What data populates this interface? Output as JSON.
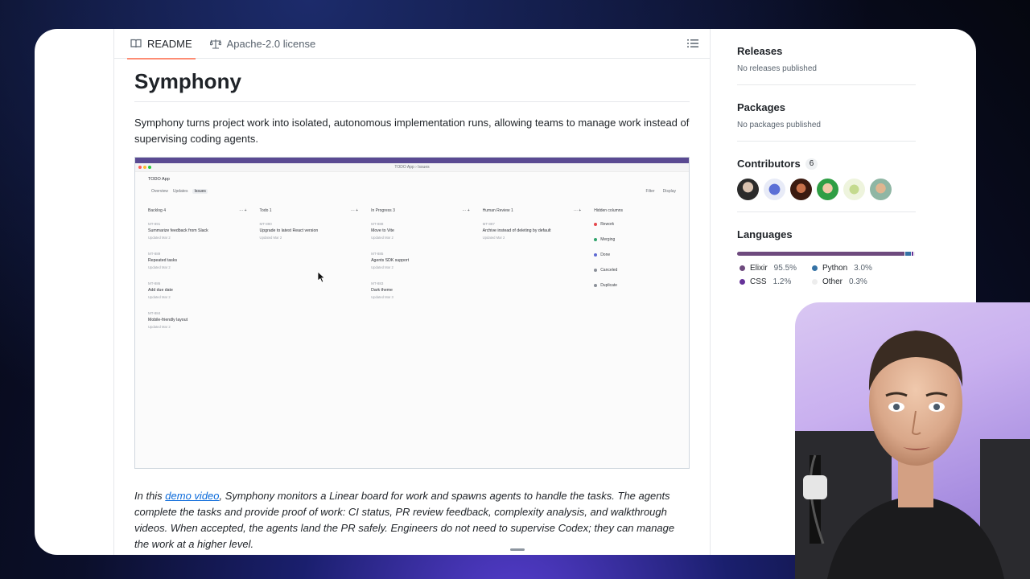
{
  "readme": {
    "tabs": [
      {
        "label": "README",
        "active": true
      },
      {
        "label": "Apache-2.0 license",
        "active": false
      }
    ],
    "title": "Symphony",
    "intro": "Symphony turns project work into isolated, autonomous implementation runs, allowing teams to manage work instead of supervising coding agents.",
    "screenshot": {
      "window_title": "TODO App › Issues",
      "app_name": "TODO App",
      "subtabs": [
        "Overview",
        "Updates",
        "Issues"
      ],
      "active_subtab": "Issues",
      "filter_label": "Filter",
      "display_label": "Display",
      "columns": [
        {
          "name": "Backlog",
          "count": "4",
          "color": "#b5b9c0",
          "cards": [
            {
              "id": "MT-891",
              "title": "Summarize feedback from Slack",
              "updated": "Updated Mar 2"
            },
            {
              "id": "MT-889",
              "title": "Repeated tasks",
              "updated": "Updated Mar 2"
            },
            {
              "id": "MT-886",
              "title": "Add due date",
              "updated": "Updated Mar 2"
            },
            {
              "id": "MT-884",
              "title": "Mobile-friendly layout",
              "updated": "Updated Mar 2"
            }
          ]
        },
        {
          "name": "Todo",
          "count": "1",
          "color": "#8a8f98",
          "cards": [
            {
              "id": "MT-890",
              "title": "Upgrade to latest React version",
              "updated": "Updated Mar 2"
            }
          ]
        },
        {
          "name": "In Progress",
          "count": "3",
          "color": "#e6b800",
          "cards": [
            {
              "id": "MT-888",
              "title": "Move to Vite",
              "updated": "Updated Mar 2"
            },
            {
              "id": "MT-885",
              "title": "Agents SDK support",
              "updated": "Updated Mar 2"
            },
            {
              "id": "MT-883",
              "title": "Dark theme",
              "updated": "Updated Mar 3"
            }
          ]
        },
        {
          "name": "Human Review",
          "count": "1",
          "color": "#e5484d",
          "cards": [
            {
              "id": "MT-887",
              "title": "Archive instead of deleting by default",
              "updated": "Updated Mar 2"
            }
          ]
        }
      ],
      "hidden_columns": {
        "label": "Hidden columns",
        "items": [
          {
            "label": "Rework",
            "color": "#e5484d"
          },
          {
            "label": "Merging",
            "color": "#30a46c"
          },
          {
            "label": "Done",
            "color": "#5e6ad2"
          },
          {
            "label": "Canceled",
            "color": "#8a8f98"
          },
          {
            "label": "Duplicate",
            "color": "#8a8f98"
          }
        ]
      }
    },
    "para": {
      "before": "In this ",
      "link": "demo video",
      "after": ", Symphony monitors a Linear board for work and spawns agents to handle the tasks. The agents complete the tasks and provide proof of work: CI status, PR review feedback, complexity analysis, and walkthrough videos. When accepted, the agents land the PR safely. Engineers do not need to supervise Codex; they can manage the work at a higher level."
    }
  },
  "sidebar": {
    "releases": {
      "title": "Releases",
      "text": "No releases published"
    },
    "packages": {
      "title": "Packages",
      "text": "No packages published"
    },
    "contributors": {
      "title": "Contributors",
      "count": "6",
      "avatar_colors": [
        "#3a3a3a",
        "#5b6fd6",
        "#8a3a1c",
        "#2f9e44",
        "#d8e6b8",
        "#7a9a8a"
      ]
    },
    "languages": {
      "title": "Languages",
      "items": [
        {
          "name": "Elixir",
          "pct": "95.5%",
          "value": 95.5,
          "color": "#6e4a7e"
        },
        {
          "name": "Python",
          "pct": "3.0%",
          "value": 3.0,
          "color": "#3572a5"
        },
        {
          "name": "CSS",
          "pct": "1.2%",
          "value": 1.2,
          "color": "#663399"
        },
        {
          "name": "Other",
          "pct": "0.3%",
          "value": 0.3,
          "color": "#ededed"
        }
      ]
    }
  }
}
